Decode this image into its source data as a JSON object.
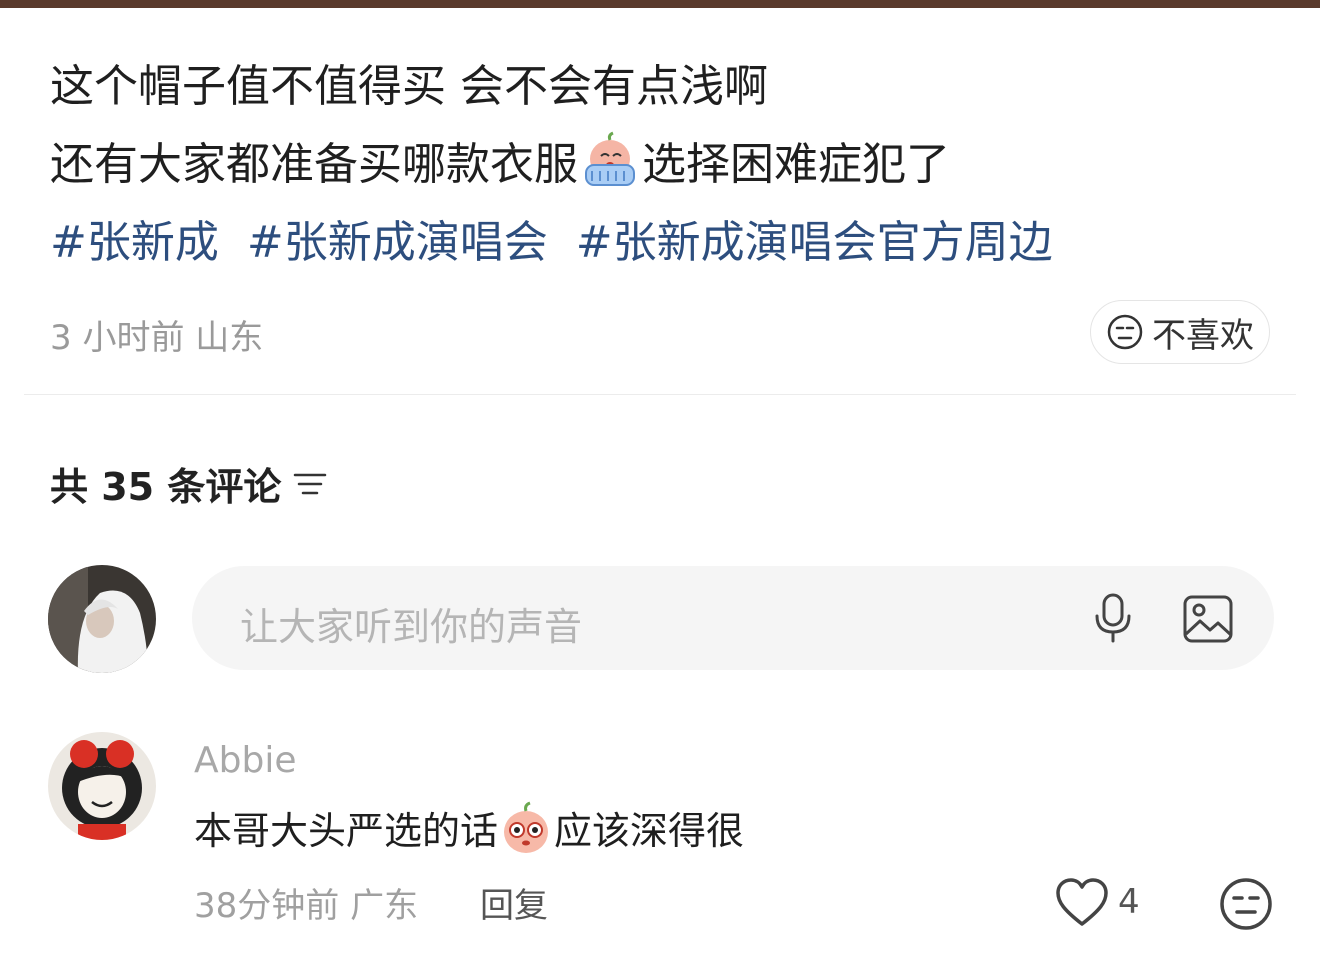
{
  "post": {
    "line1": "这个帽子值不值得买 会不会有点浅啊",
    "line2_before": "还有大家都准备买哪款衣服",
    "line2_after": "选择困难症犯了",
    "tags": [
      "#张新成",
      "#张新成演唱会",
      "#张新成演唱会官方周边"
    ],
    "time": "3 小时前",
    "location": "山东",
    "dislike_label": "不喜欢"
  },
  "comments_header": {
    "label": "共 35 条评论"
  },
  "input": {
    "placeholder": "让大家听到你的声音"
  },
  "comment": {
    "username": "Abbie",
    "text_before": "本哥大头严选的话",
    "text_after": "应该深得很",
    "time": "38分钟前",
    "location": "广东",
    "reply_label": "回复",
    "like_count": "4"
  },
  "colors": {
    "tag": "#2d4e7e",
    "muted": "#9a9a9a",
    "topbar": "#5a3a2c"
  }
}
